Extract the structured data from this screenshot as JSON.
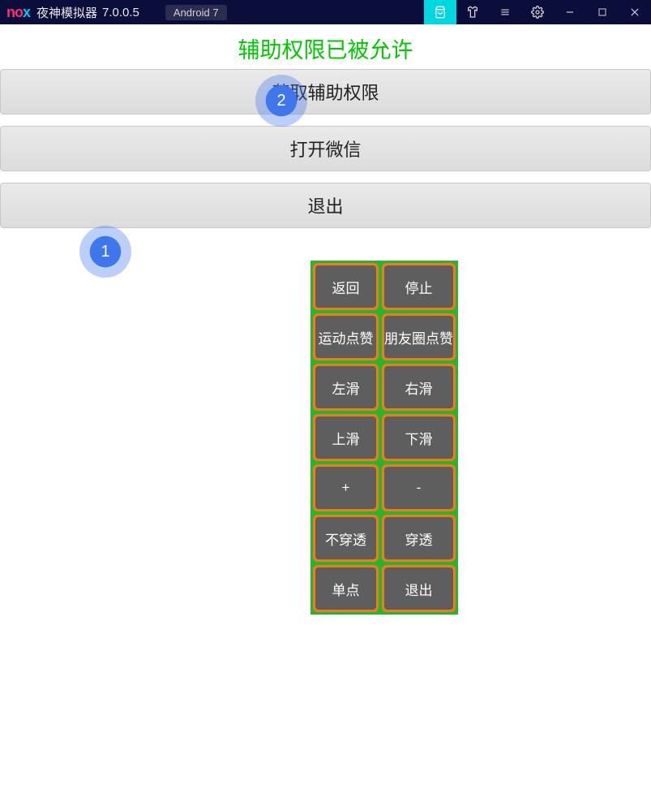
{
  "titlebar": {
    "logo_part1": "no",
    "logo_part2": "x",
    "app_name": "夜神模拟器",
    "version": "7.0.0.5",
    "android_badge": "Android 7"
  },
  "status_text": "辅助权限已被允许",
  "main_buttons": {
    "accessibility": "获取辅助权限",
    "open_wechat": "打开微信",
    "exit": "退出"
  },
  "grid": {
    "back": "返回",
    "stop": "停止",
    "sport_like": "运动点赞",
    "moments_like": "朋友圈点赞",
    "swipe_left": "左滑",
    "swipe_right": "右滑",
    "swipe_up": "上滑",
    "swipe_down": "下滑",
    "plus": "+",
    "minus": "-",
    "no_passthrough": "不穿透",
    "passthrough": "穿透",
    "single": "单点",
    "exit": "退出"
  },
  "badges": {
    "one": "1",
    "two": "2"
  }
}
